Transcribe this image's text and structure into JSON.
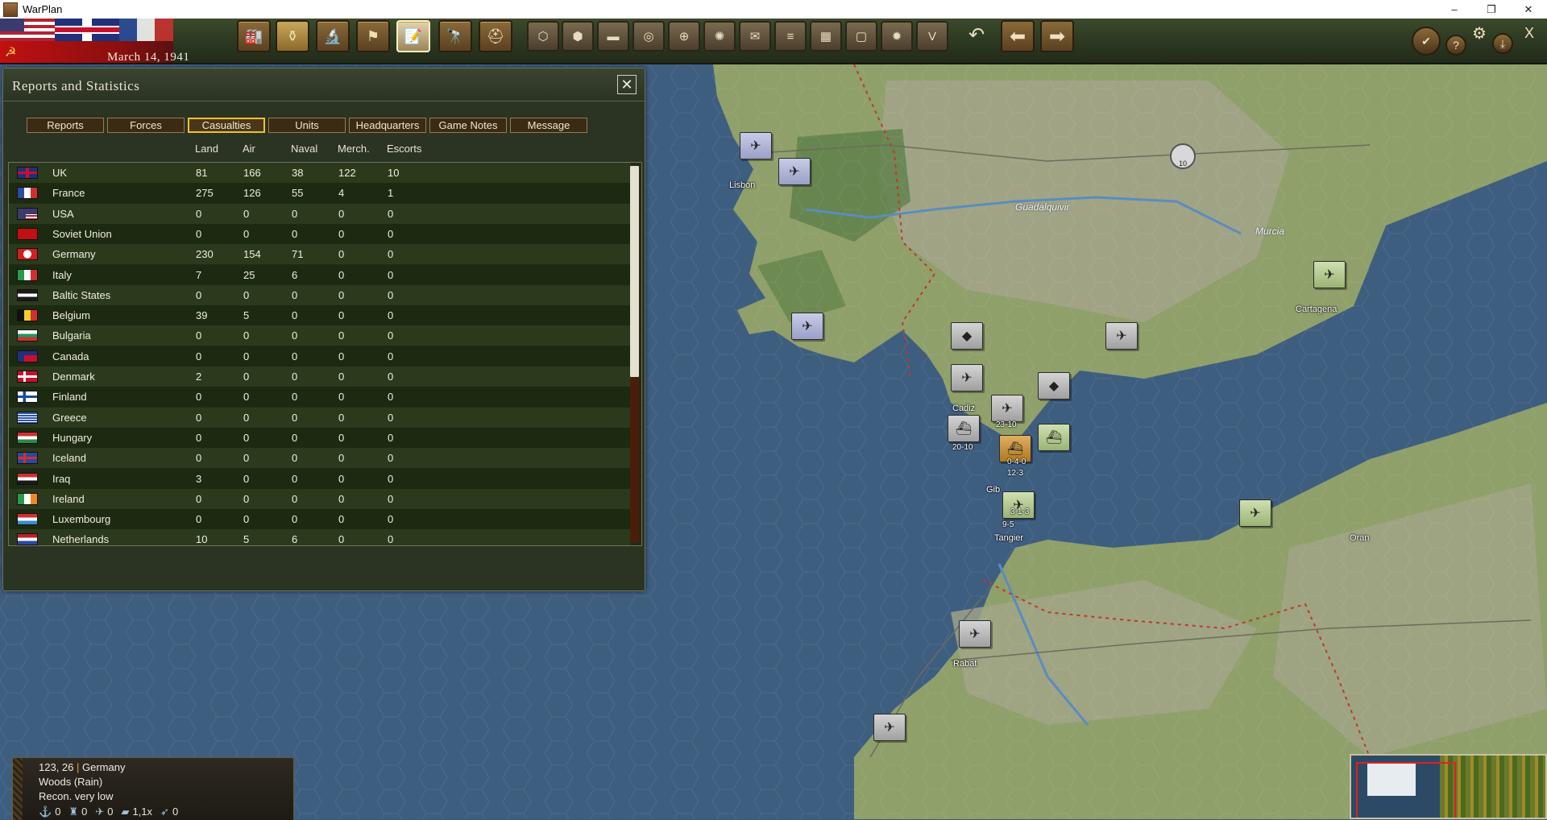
{
  "window": {
    "title": "WarPlan",
    "controls": [
      "–",
      "❐",
      "✕"
    ]
  },
  "topbar": {
    "date": "March 14, 1941",
    "main_buttons": [
      {
        "icon": "factory-icon",
        "glyph": "🏭"
      },
      {
        "icon": "production-icon",
        "glyph": "⚱"
      },
      {
        "icon": "research-icon",
        "glyph": "🔬"
      },
      {
        "icon": "flag-icon",
        "glyph": "⚑"
      },
      {
        "icon": "reports-icon",
        "glyph": "📝"
      },
      {
        "icon": "binoculars-icon",
        "glyph": "🔭"
      },
      {
        "icon": "helmet-icon",
        "glyph": "⛑"
      }
    ],
    "hex_buttons": [
      {
        "icon": "hex-terrain-icon",
        "glyph": "⬡"
      },
      {
        "icon": "hex-grid-icon",
        "glyph": "⬢"
      },
      {
        "icon": "supply-icon",
        "glyph": "▬"
      },
      {
        "icon": "coins-icon",
        "glyph": "◎"
      },
      {
        "icon": "target-icon",
        "glyph": "⊕"
      },
      {
        "icon": "sun-icon",
        "glyph": "✺"
      },
      {
        "icon": "mail-icon",
        "glyph": "✉"
      },
      {
        "icon": "rail-icon",
        "glyph": "≡"
      },
      {
        "icon": "grid-icon",
        "glyph": "▦"
      },
      {
        "icon": "frame-icon",
        "glyph": "▢"
      },
      {
        "icon": "explosion-icon",
        "glyph": "✹"
      },
      {
        "icon": "victory-icon",
        "glyph": "V"
      }
    ],
    "undo_glyph": "↶",
    "back_glyph": "⬅",
    "forward_glyph": "➡",
    "right_buttons": [
      {
        "icon": "check-icon",
        "glyph": "✔"
      },
      {
        "icon": "help-icon",
        "glyph": "?"
      },
      {
        "icon": "settings-icon",
        "glyph": "⚙"
      },
      {
        "icon": "download-icon",
        "glyph": "⤓"
      },
      {
        "icon": "close-icon",
        "glyph": "X"
      }
    ]
  },
  "panel": {
    "title": "Reports and Statistics",
    "close_glyph": "✕",
    "tabs": [
      "Reports",
      "Forces",
      "Casualties",
      "Units",
      "Headquarters",
      "Game Notes",
      "Message"
    ],
    "active_tab": 2,
    "columns": [
      "Land",
      "Air",
      "Naval",
      "Merch.",
      "Escorts"
    ],
    "rows": [
      {
        "country": "UK",
        "flag": "uk",
        "land": "81",
        "air": "166",
        "naval": "38",
        "merch": "122",
        "escorts": "10"
      },
      {
        "country": "France",
        "flag": "fr",
        "land": "275",
        "air": "126",
        "naval": "55",
        "merch": "4",
        "escorts": "1"
      },
      {
        "country": "USA",
        "flag": "us",
        "land": "0",
        "air": "0",
        "naval": "0",
        "merch": "0",
        "escorts": "0"
      },
      {
        "country": "Soviet Union",
        "flag": "su",
        "land": "0",
        "air": "0",
        "naval": "0",
        "merch": "0",
        "escorts": "0"
      },
      {
        "country": "Germany",
        "flag": "de",
        "land": "230",
        "air": "154",
        "naval": "71",
        "merch": "0",
        "escorts": "0"
      },
      {
        "country": "Italy",
        "flag": "it",
        "land": "7",
        "air": "25",
        "naval": "6",
        "merch": "0",
        "escorts": "0"
      },
      {
        "country": "Baltic States",
        "flag": "bs",
        "land": "0",
        "air": "0",
        "naval": "0",
        "merch": "0",
        "escorts": "0"
      },
      {
        "country": "Belgium",
        "flag": "be",
        "land": "39",
        "air": "5",
        "naval": "0",
        "merch": "0",
        "escorts": "0"
      },
      {
        "country": "Bulgaria",
        "flag": "bg",
        "land": "0",
        "air": "0",
        "naval": "0",
        "merch": "0",
        "escorts": "0"
      },
      {
        "country": "Canada",
        "flag": "ca",
        "land": "0",
        "air": "0",
        "naval": "0",
        "merch": "0",
        "escorts": "0"
      },
      {
        "country": "Denmark",
        "flag": "dk",
        "land": "2",
        "air": "0",
        "naval": "0",
        "merch": "0",
        "escorts": "0"
      },
      {
        "country": "Finland",
        "flag": "fi",
        "land": "0",
        "air": "0",
        "naval": "0",
        "merch": "0",
        "escorts": "0"
      },
      {
        "country": "Greece",
        "flag": "gr",
        "land": "0",
        "air": "0",
        "naval": "0",
        "merch": "0",
        "escorts": "0"
      },
      {
        "country": "Hungary",
        "flag": "hu",
        "land": "0",
        "air": "0",
        "naval": "0",
        "merch": "0",
        "escorts": "0"
      },
      {
        "country": "Iceland",
        "flag": "is",
        "land": "0",
        "air": "0",
        "naval": "0",
        "merch": "0",
        "escorts": "0"
      },
      {
        "country": "Iraq",
        "flag": "iq",
        "land": "3",
        "air": "0",
        "naval": "0",
        "merch": "0",
        "escorts": "0"
      },
      {
        "country": "Ireland",
        "flag": "ie",
        "land": "0",
        "air": "0",
        "naval": "0",
        "merch": "0",
        "escorts": "0"
      },
      {
        "country": "Luxembourg",
        "flag": "lu",
        "land": "0",
        "air": "0",
        "naval": "0",
        "merch": "0",
        "escorts": "0"
      },
      {
        "country": "Netherlands",
        "flag": "nl",
        "land": "10",
        "air": "5",
        "naval": "6",
        "merch": "0",
        "escorts": "0"
      }
    ],
    "scroll_fraction_visible": 0.56
  },
  "map": {
    "cities": [
      "Lisbon",
      "Cadiz",
      "Gib",
      "Tangier",
      "Rabat",
      "Cartagena",
      "Oran"
    ],
    "rivers": [
      "Guadalquivir",
      "Murcia"
    ],
    "units": [
      {
        "side": "uk",
        "glyph": "✈"
      },
      {
        "side": "uk",
        "glyph": "✈"
      },
      {
        "side": "uk",
        "glyph": "✈"
      },
      {
        "side": "de",
        "glyph": "✈"
      },
      {
        "side": "de",
        "glyph": "◆"
      },
      {
        "side": "de",
        "glyph": "◆"
      },
      {
        "side": "de",
        "glyph": "✈"
      },
      {
        "side": "de",
        "glyph": "⛴"
      },
      {
        "side": "de",
        "glyph": "✈"
      },
      {
        "side": "de",
        "glyph": "✈"
      },
      {
        "side": "de",
        "glyph": "✈"
      },
      {
        "side": "it",
        "glyph": "✈"
      },
      {
        "side": "it",
        "glyph": "✈"
      },
      {
        "side": "it",
        "glyph": "⛴"
      },
      {
        "side": "it",
        "glyph": "✈"
      },
      {
        "side": "es",
        "glyph": "⛴"
      }
    ],
    "unit_labels": [
      "23-10",
      "20-10",
      "0-4-0",
      "12-3",
      "3-1-3",
      "9-5"
    ],
    "badge_number": "10"
  },
  "infobox": {
    "coords": "123, 26",
    "owner": "Germany",
    "terrain": "Woods (Rain)",
    "recon": "Recon. very low",
    "stats": [
      {
        "icon": "anchor-icon",
        "glyph": "⚓",
        "value": "0"
      },
      {
        "icon": "soldier-icon",
        "glyph": "♜",
        "value": "0"
      },
      {
        "icon": "plane-icon",
        "glyph": "✈",
        "value": "0"
      },
      {
        "icon": "tank-icon",
        "glyph": "▰",
        "value": "1,1x"
      },
      {
        "icon": "jet-icon",
        "glyph": "➶",
        "value": "0"
      }
    ]
  }
}
